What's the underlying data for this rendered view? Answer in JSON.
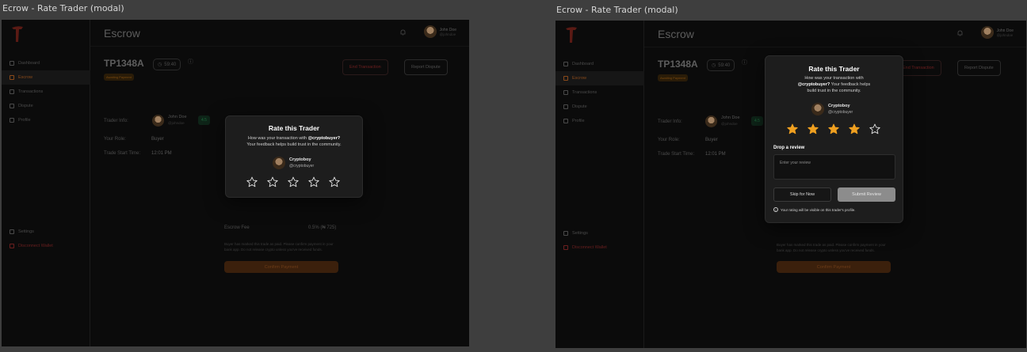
{
  "screens": [
    {
      "frame_label": "Ecrow - Rate Trader (modal)",
      "app": {
        "page_title": "Escrow",
        "user": {
          "name": "John Doe",
          "handle": "@johndoe"
        }
      },
      "sidebar": {
        "items": [
          {
            "label": "Dashboard",
            "icon": "grid-icon"
          },
          {
            "label": "Escrow",
            "icon": "lock-icon",
            "active": true
          },
          {
            "label": "Transactions",
            "icon": "list-icon"
          },
          {
            "label": "Dispute",
            "icon": "warning-icon"
          },
          {
            "label": "Profile",
            "icon": "user-icon"
          }
        ],
        "bottom": [
          {
            "label": "Settings",
            "icon": "gear-icon"
          },
          {
            "label": "Disconnect Wallet",
            "icon": "logout-icon"
          }
        ]
      },
      "transaction": {
        "id": "TP1348A",
        "timer": "59:40",
        "status": "Awaiting Payment",
        "end_label": "End Transaction",
        "dispute_label": "Report Dispute",
        "trader_info_label": "Trader Info:",
        "trader_name": "John Doe",
        "trader_handle": "@johndoe",
        "trader_rating": "4.5",
        "role_label": "Your Role:",
        "role_value": "Buyer",
        "start_label": "Trade Start Time:",
        "start_value": "12:01 PM",
        "fee_label": "Escrow Fee",
        "fee_value": "0.5% (₦ 725)",
        "note": "Buyer has marked this trade as paid. Please confirm payment in your bank app. Do not release crypto unless you've received funds.",
        "confirm_label": "Confirm Payment"
      },
      "modal": {
        "title": "Rate this Trader",
        "subtitle_prefix": "How was your transaction with",
        "subtitle_user": "@cryptobuyer?",
        "subtitle_rest": "Your feedback helps build trust in the community.",
        "trader_name": "Cryptoboy",
        "trader_handle": "@cryptobuyer",
        "rating": 0,
        "max_rating": 5,
        "expanded": false
      }
    },
    {
      "frame_label": "Ecrow - Rate Trader (modal)",
      "app": {
        "page_title": "Escrow",
        "user": {
          "name": "John Doe",
          "handle": "@johndoe"
        }
      },
      "sidebar": {
        "items": [
          {
            "label": "Dashboard",
            "icon": "grid-icon"
          },
          {
            "label": "Escrow",
            "icon": "lock-icon",
            "active": true
          },
          {
            "label": "Transactions",
            "icon": "list-icon"
          },
          {
            "label": "Dispute",
            "icon": "warning-icon"
          },
          {
            "label": "Profile",
            "icon": "user-icon"
          }
        ],
        "bottom": [
          {
            "label": "Settings",
            "icon": "gear-icon"
          },
          {
            "label": "Disconnect Wallet",
            "icon": "logout-icon"
          }
        ]
      },
      "transaction": {
        "id": "TP1348A",
        "timer": "59:40",
        "status": "Awaiting Payment",
        "end_label": "End Transaction",
        "dispute_label": "Report Dispute",
        "trader_info_label": "Trader Info:",
        "trader_name": "John Doe",
        "trader_handle": "@johndoe",
        "trader_rating": "4.5",
        "role_label": "Your Role:",
        "role_value": "Buyer",
        "start_label": "Trade Start Time:",
        "start_value": "12:01 PM",
        "note": "Buyer has marked this trade as paid. Please confirm payment in your bank app. Do not release crypto unless you've received funds.",
        "confirm_label": "Confirm Payment"
      },
      "modal": {
        "title": "Rate this Trader",
        "subtitle_prefix": "How was your transaction with",
        "subtitle_user": "@cryptobuyer?",
        "subtitle_rest": "Your feedback helps build trust in the community.",
        "trader_name": "Cryptoboy",
        "trader_handle": "@cryptobuyer",
        "rating": 4,
        "max_rating": 5,
        "expanded": true,
        "review_label": "Drop a review",
        "review_placeholder": "Enter your review",
        "skip_label": "Skip for Now",
        "submit_label": "Submit Review",
        "visibility_note": "Your rating will be visible on this trader's profile."
      }
    }
  ],
  "colors": {
    "star_filled": "#f0a020",
    "star_empty": "#e0e0e0",
    "accent_orange": "#f07a1a",
    "brand_red": "#e23a2a"
  }
}
